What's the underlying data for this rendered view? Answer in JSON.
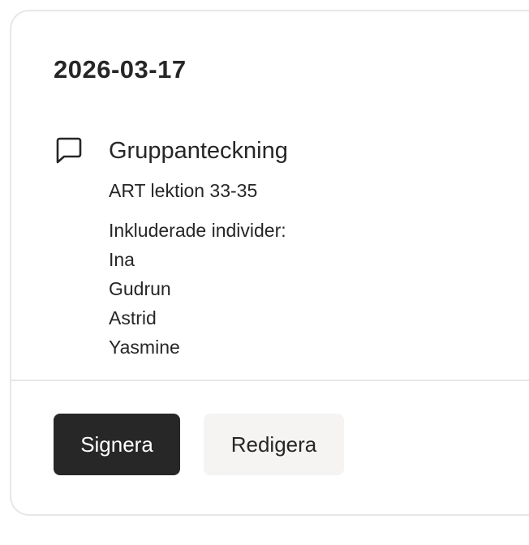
{
  "note_card": {
    "date": "2026-03-17",
    "icon": "chat-bubble-icon",
    "title": "Gruppanteckning",
    "subtitle": "ART lektion 33-35",
    "included_label": "Inkluderade individer:",
    "individuals": [
      "Ina",
      "Gudrun",
      "Astrid",
      "Yasmine"
    ]
  },
  "actions": {
    "sign_label": "Signera",
    "edit_label": "Redigera"
  },
  "colors": {
    "primary_button_bg": "#272727",
    "secondary_button_bg": "#f5f4f2",
    "border": "#e7e7e7",
    "text": "#262626"
  }
}
